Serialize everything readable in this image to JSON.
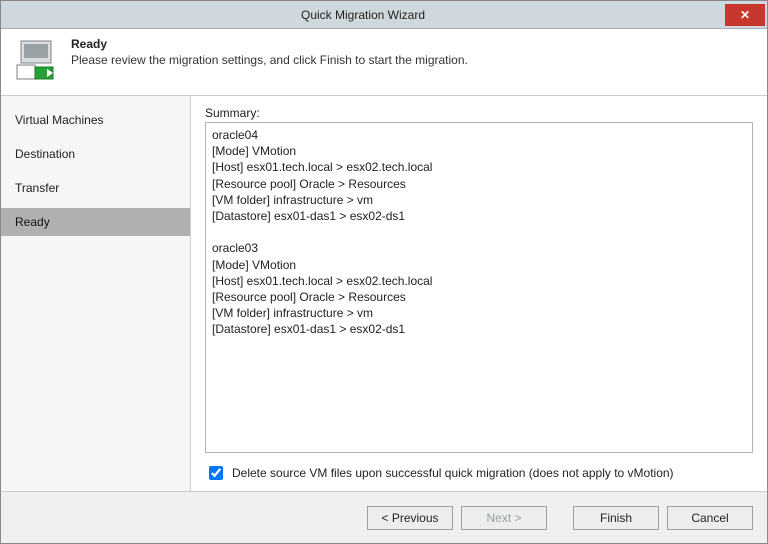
{
  "window": {
    "title": "Quick Migration Wizard",
    "close_label": "✕"
  },
  "header": {
    "heading": "Ready",
    "subtext": "Please review the migration settings, and click Finish to start the migration."
  },
  "sidebar": {
    "steps": [
      {
        "label": "Virtual Machines",
        "active": false
      },
      {
        "label": "Destination",
        "active": false
      },
      {
        "label": "Transfer",
        "active": false
      },
      {
        "label": "Ready",
        "active": true
      }
    ]
  },
  "content": {
    "summary_label": "Summary:",
    "summary_text": "oracle04\n[Mode] VMotion\n[Host] esx01.tech.local > esx02.tech.local\n[Resource pool] Oracle > Resources\n[VM folder] infrastructure > vm\n[Datastore] esx01-das1 > esx02-ds1\n\noracle03\n[Mode] VMotion\n[Host] esx01.tech.local > esx02.tech.local\n[Resource pool] Oracle > Resources\n[VM folder] infrastructure > vm\n[Datastore] esx01-das1 > esx02-ds1",
    "checkbox_checked": true,
    "checkbox_label": "Delete source VM files upon successful quick migration (does not apply to vMotion)"
  },
  "footer": {
    "previous": "< Previous",
    "next": "Next >",
    "finish": "Finish",
    "cancel": "Cancel",
    "next_enabled": false
  }
}
